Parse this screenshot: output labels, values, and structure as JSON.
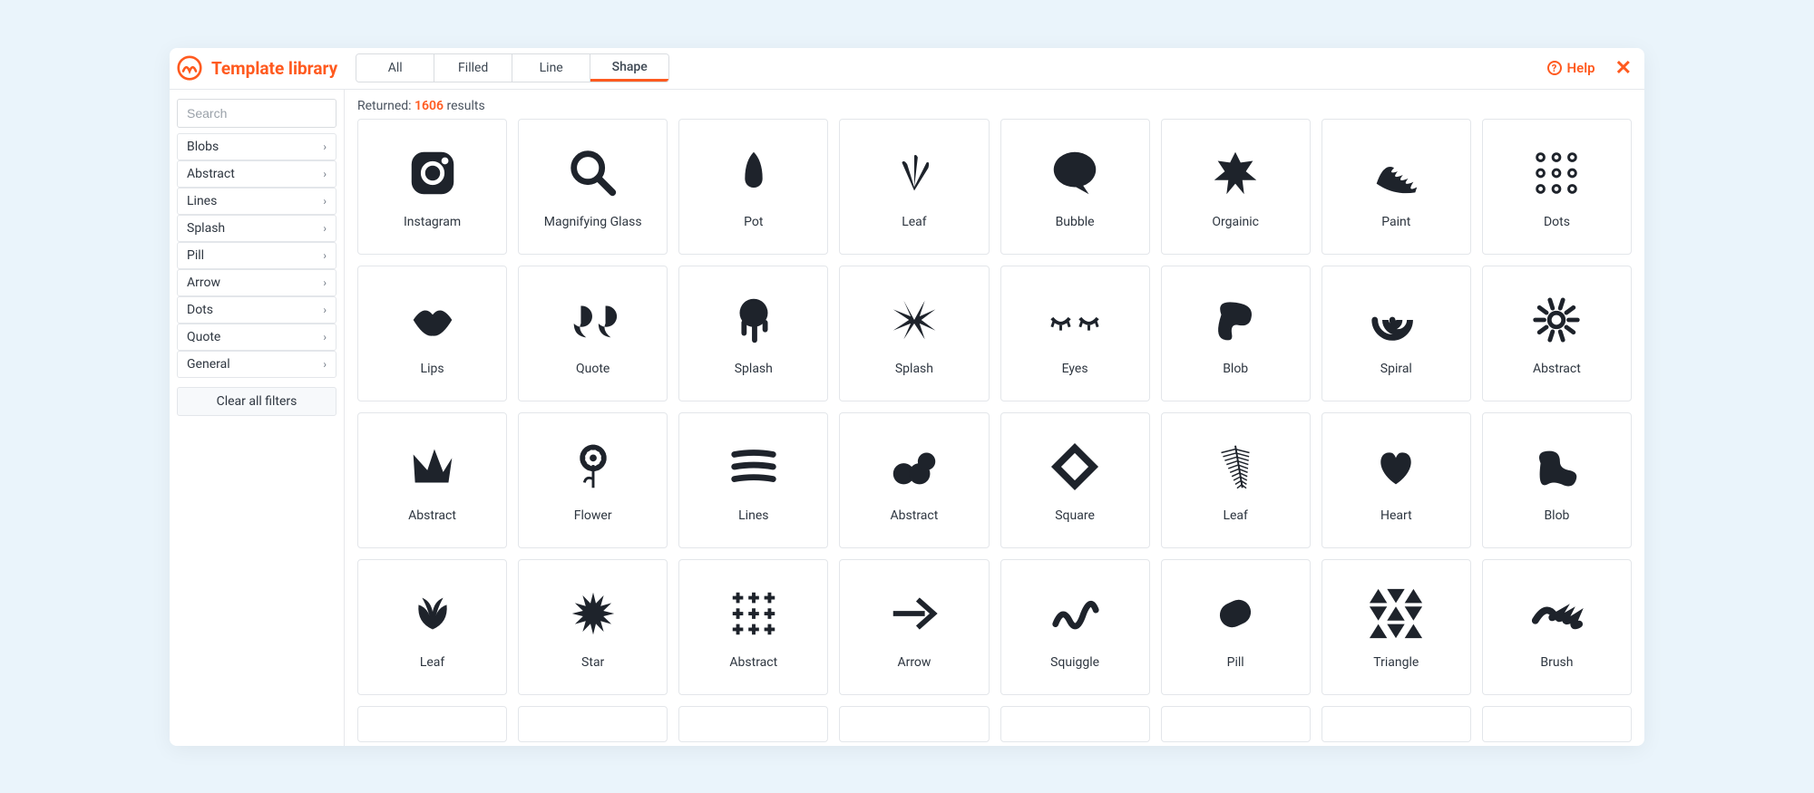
{
  "header": {
    "title": "Template library",
    "help_label": "Help"
  },
  "tabs": [
    {
      "label": "All",
      "active": false
    },
    {
      "label": "Filled",
      "active": false
    },
    {
      "label": "Line",
      "active": false
    },
    {
      "label": "Shape",
      "active": true
    }
  ],
  "sidebar": {
    "search_placeholder": "Search",
    "categories": [
      {
        "label": "Blobs"
      },
      {
        "label": "Abstract"
      },
      {
        "label": "Lines"
      },
      {
        "label": "Splash"
      },
      {
        "label": "Pill"
      },
      {
        "label": "Arrow"
      },
      {
        "label": "Dots"
      },
      {
        "label": "Quote"
      },
      {
        "label": "General"
      }
    ],
    "clear_label": "Clear all filters"
  },
  "results": {
    "prefix": "Returned:",
    "count": "1606",
    "suffix": "results"
  },
  "items": [
    {
      "label": "Instagram",
      "icon": "instagram"
    },
    {
      "label": "Magnifying Glass",
      "icon": "magnify"
    },
    {
      "label": "Pot",
      "icon": "pot"
    },
    {
      "label": "Leaf",
      "icon": "leaf-fan"
    },
    {
      "label": "Bubble",
      "icon": "bubble"
    },
    {
      "label": "Orgainic",
      "icon": "splat"
    },
    {
      "label": "Paint",
      "icon": "paint"
    },
    {
      "label": "Dots",
      "icon": "dots"
    },
    {
      "label": "Lips",
      "icon": "lips"
    },
    {
      "label": "Quote",
      "icon": "quote"
    },
    {
      "label": "Splash",
      "icon": "drip"
    },
    {
      "label": "Splash",
      "icon": "splash2"
    },
    {
      "label": "Eyes",
      "icon": "eyes"
    },
    {
      "label": "Blob",
      "icon": "blob"
    },
    {
      "label": "Spiral",
      "icon": "spiral"
    },
    {
      "label": "Abstract",
      "icon": "sun"
    },
    {
      "label": "Abstract",
      "icon": "crown"
    },
    {
      "label": "Flower",
      "icon": "flower"
    },
    {
      "label": "Lines",
      "icon": "hlines"
    },
    {
      "label": "Abstract",
      "icon": "bumps"
    },
    {
      "label": "Square",
      "icon": "diamond"
    },
    {
      "label": "Leaf",
      "icon": "fern"
    },
    {
      "label": "Heart",
      "icon": "heart"
    },
    {
      "label": "Blob",
      "icon": "blob2"
    },
    {
      "label": "Leaf",
      "icon": "leaves"
    },
    {
      "label": "Star",
      "icon": "starburst"
    },
    {
      "label": "Abstract",
      "icon": "plusgrid"
    },
    {
      "label": "Arrow",
      "icon": "arrow"
    },
    {
      "label": "Squiggle",
      "icon": "squiggle"
    },
    {
      "label": "Pill",
      "icon": "pill"
    },
    {
      "label": "Triangle",
      "icon": "trigrid"
    },
    {
      "label": "Brush",
      "icon": "brush"
    }
  ]
}
